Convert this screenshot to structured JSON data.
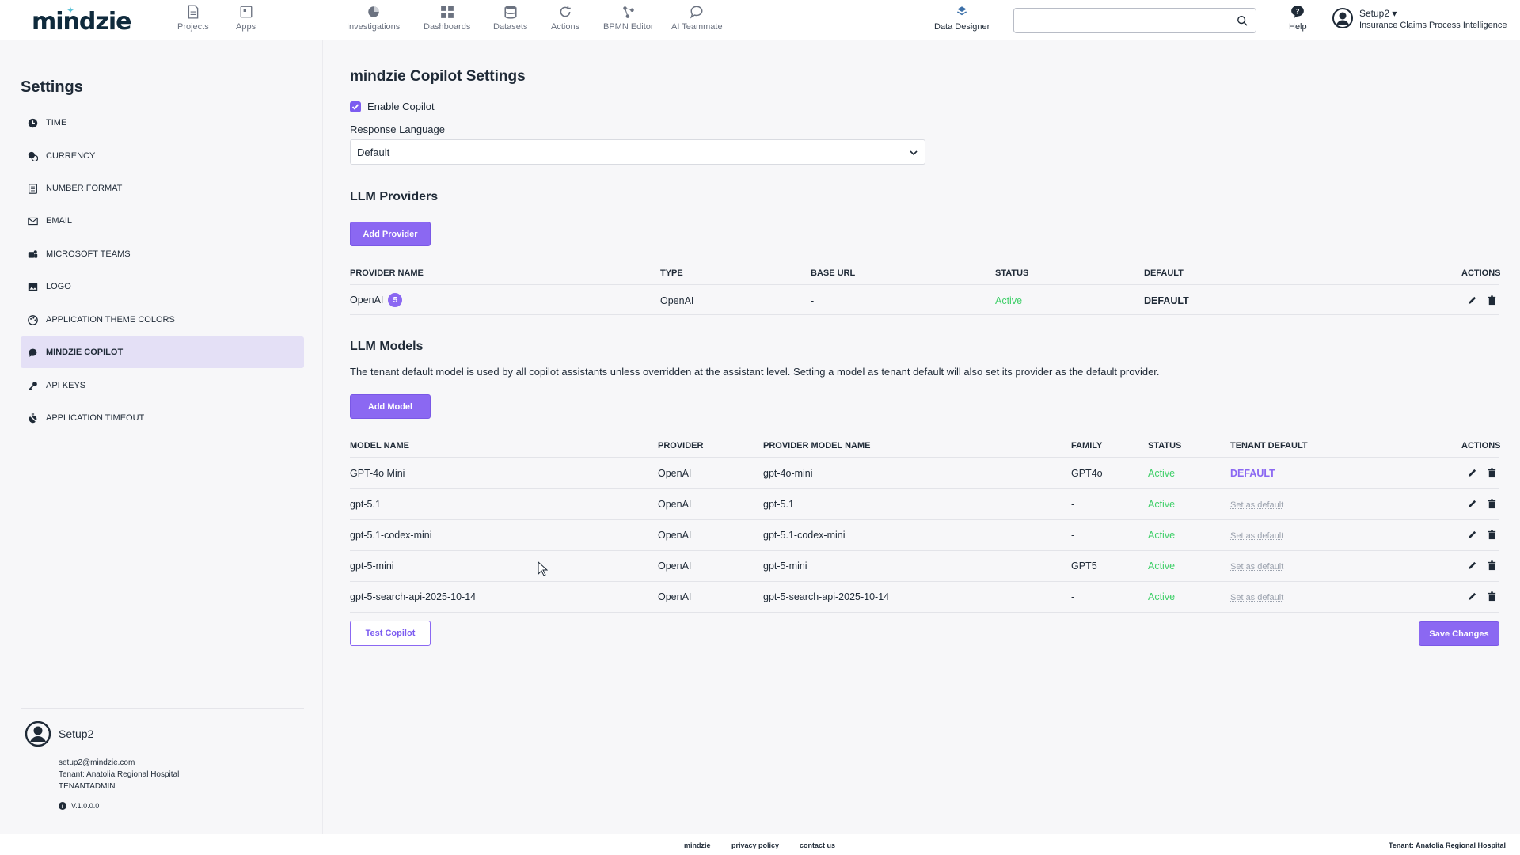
{
  "header": {
    "logo": "mindzie",
    "nav": [
      {
        "label": "Projects",
        "icon": "file-icon"
      },
      {
        "label": "Apps",
        "icon": "apps-icon"
      },
      {
        "label": "Investigations",
        "icon": "pie-icon"
      },
      {
        "label": "Dashboards",
        "icon": "grid-icon"
      },
      {
        "label": "Datasets",
        "icon": "database-icon"
      },
      {
        "label": "Actions",
        "icon": "actions-icon"
      },
      {
        "label": "BPMN Editor",
        "icon": "bpmn-icon"
      },
      {
        "label": "AI Teammate",
        "icon": "chat-icon"
      }
    ],
    "data_designer": "Data Designer",
    "search_placeholder": "",
    "help": "Help",
    "user_name": "Setup2",
    "project": "Insurance Claims Process Intelligence"
  },
  "sidebar": {
    "title": "Settings",
    "items": [
      {
        "label": "TIME",
        "icon": "clock-icon"
      },
      {
        "label": "CURRENCY",
        "icon": "currency-icon"
      },
      {
        "label": "NUMBER FORMAT",
        "icon": "number-icon"
      },
      {
        "label": "EMAIL",
        "icon": "mail-icon"
      },
      {
        "label": "MICROSOFT TEAMS",
        "icon": "teams-icon"
      },
      {
        "label": "LOGO",
        "icon": "image-icon"
      },
      {
        "label": "APPLICATION THEME COLORS",
        "icon": "palette-icon"
      },
      {
        "label": "MINDZIE COPILOT",
        "icon": "copilot-icon",
        "active": true
      },
      {
        "label": "API KEYS",
        "icon": "key-icon"
      },
      {
        "label": "APPLICATION TIMEOUT",
        "icon": "timeout-icon"
      }
    ],
    "user": {
      "name": "Setup2",
      "email": "setup2@mindzie.com",
      "tenant": "Tenant: Anatolia Regional Hospital",
      "role": "TENANTADMIN",
      "version": "V.1.0.0.0"
    }
  },
  "main": {
    "title": "mindzie Copilot Settings",
    "enable_copilot_label": "Enable Copilot",
    "enable_copilot_checked": true,
    "response_language_label": "Response Language",
    "response_language_value": "Default",
    "providers": {
      "title": "LLM Providers",
      "add_button": "Add Provider",
      "headers": [
        "PROVIDER NAME",
        "TYPE",
        "BASE URL",
        "STATUS",
        "DEFAULT",
        "ACTIONS"
      ],
      "rows": [
        {
          "name": "OpenAI",
          "badge": "5",
          "type": "OpenAI",
          "base_url": "-",
          "status": "Active",
          "default": "DEFAULT"
        }
      ]
    },
    "models": {
      "title": "LLM Models",
      "description": "The tenant default model is used by all copilot assistants unless overridden at the assistant level. Setting a model as tenant default will also set its provider as the default provider.",
      "add_button": "Add Model",
      "headers": [
        "MODEL NAME",
        "PROVIDER",
        "PROVIDER MODEL NAME",
        "FAMILY",
        "STATUS",
        "TENANT DEFAULT",
        "ACTIONS"
      ],
      "rows": [
        {
          "name": "GPT-4o Mini",
          "provider": "OpenAI",
          "provider_model": "gpt-4o-mini",
          "family": "GPT4o",
          "status": "Active",
          "tenant_default": "DEFAULT"
        },
        {
          "name": "gpt-5.1",
          "provider": "OpenAI",
          "provider_model": "gpt-5.1",
          "family": "-",
          "status": "Active",
          "tenant_default": "Set as default"
        },
        {
          "name": "gpt-5.1-codex-mini",
          "provider": "OpenAI",
          "provider_model": "gpt-5.1-codex-mini",
          "family": "-",
          "status": "Active",
          "tenant_default": "Set as default"
        },
        {
          "name": "gpt-5-mini",
          "provider": "OpenAI",
          "provider_model": "gpt-5-mini",
          "family": "GPT5",
          "status": "Active",
          "tenant_default": "Set as default"
        },
        {
          "name": "gpt-5-search-api-2025-10-14",
          "provider": "OpenAI",
          "provider_model": "gpt-5-search-api-2025-10-14",
          "family": "-",
          "status": "Active",
          "tenant_default": "Set as default"
        }
      ]
    },
    "test_button": "Test Copilot",
    "save_button": "Save Changes"
  },
  "footer": {
    "brand": "mindzie",
    "privacy": "privacy policy",
    "contact": "contact us",
    "tenant": "Tenant: Anatolia Regional Hospital"
  },
  "colors": {
    "accent": "#8b68f2",
    "active_status": "#3ecf68",
    "text": "#1f2a37"
  }
}
